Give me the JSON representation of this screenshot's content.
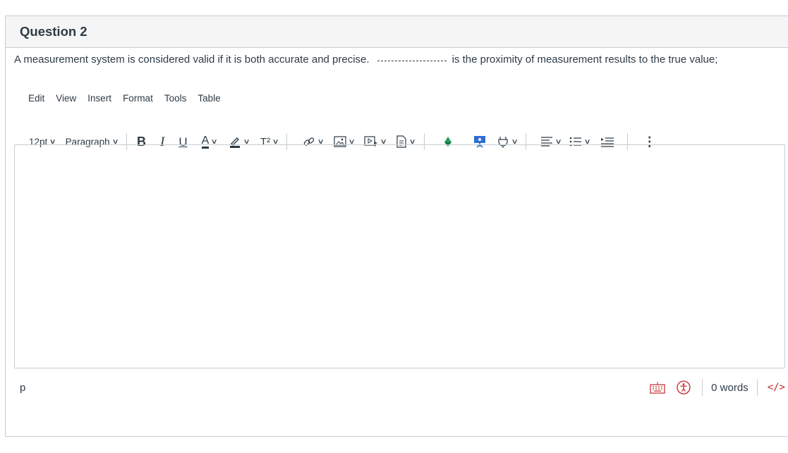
{
  "question": {
    "title": "Question 2",
    "text_before": "A measurement system is considered valid if it is both accurate and precise.",
    "text_after": "is the proximity of measurement results to the true value;"
  },
  "menubar": [
    "Edit",
    "View",
    "Insert",
    "Format",
    "Tools",
    "Table"
  ],
  "toolbar": {
    "font_size": "12pt",
    "block_format": "Paragraph",
    "bold": "B",
    "italic": "I",
    "underline": "U",
    "text_color": "A",
    "superscript": "T²"
  },
  "statusbar": {
    "element_path": "p",
    "word_count": "0 words",
    "html_toggle": "</>"
  },
  "colors": {
    "accent_red": "#c1272d",
    "border": "#c7cdd1",
    "text": "#2d3b45"
  }
}
